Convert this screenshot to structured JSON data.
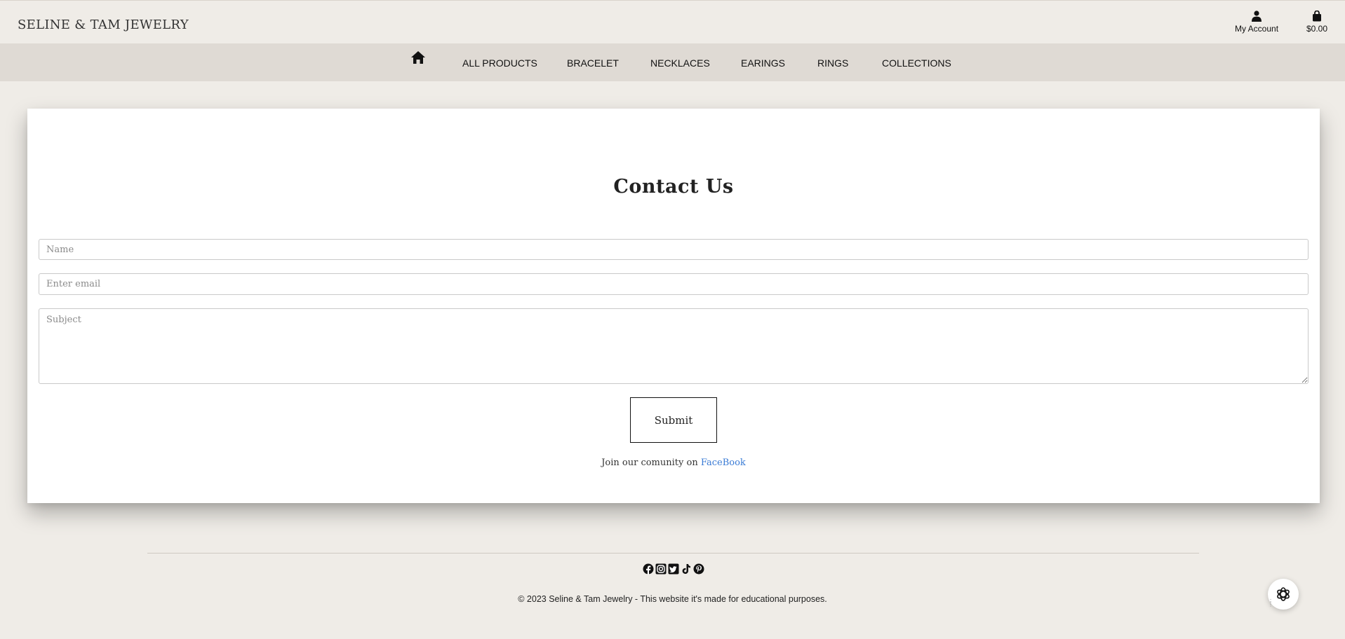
{
  "header": {
    "brand": "SELINE & TAM JEWELRY",
    "account_label": "My Account",
    "cart_total": "$0.00",
    "icons": {
      "account": "user-icon",
      "cart": "shopping-bag-icon"
    }
  },
  "nav": {
    "home_icon": "home-icon",
    "items": [
      {
        "label": "ALL PRODUCTS"
      },
      {
        "label": "BRACELET"
      },
      {
        "label": "NECKLACES"
      },
      {
        "label": "EARINGS"
      },
      {
        "label": "RINGS"
      },
      {
        "label": "COLLECTIONS"
      }
    ]
  },
  "contact": {
    "title": "Contact Us",
    "name_placeholder": "Name",
    "email_placeholder": "Enter email",
    "subject_placeholder": "Subject",
    "name_value": "",
    "email_value": "",
    "subject_value": "",
    "submit_label": "Submit",
    "join_text": "Join our comunity on",
    "join_link": "FaceBook"
  },
  "footer": {
    "socials": [
      "facebook-icon",
      "instagram-icon",
      "twitter-icon",
      "tiktok-icon",
      "pinterest-icon"
    ],
    "copyright": "© 2023 Seline & Tam Jewelry - This website it's made for educational purposes.",
    "chat_icon": "chat-assistant-icon"
  },
  "colors": {
    "page_bg": "#efece7",
    "nav_bg": "#dfdad4",
    "card_bg": "#ffffff",
    "link": "#3a7bd5",
    "text": "#111111"
  }
}
